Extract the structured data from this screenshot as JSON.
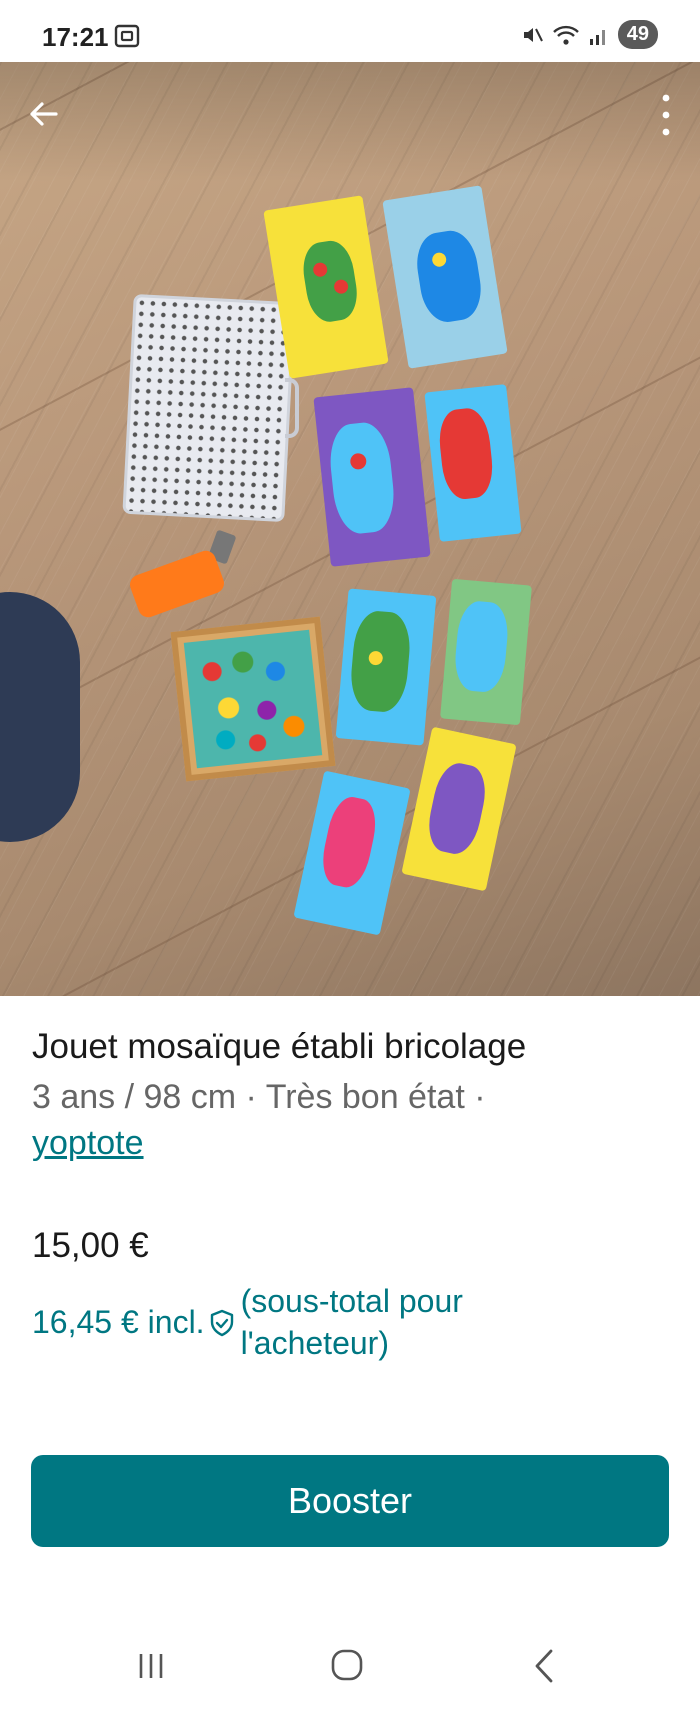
{
  "status_bar": {
    "time": "17:21",
    "battery": "49",
    "icons": [
      "screenshot-icon",
      "mute-icon",
      "wifi-icon",
      "signal-icon"
    ]
  },
  "photo": {
    "image_count": 5,
    "active_index": 0,
    "icons": {
      "back": "arrow-left-icon",
      "more": "more-vertical-icon"
    }
  },
  "item": {
    "title": "Jouet mosaïque établi bricolage",
    "subtitle": "3 ans / 98 cm · Très bon état ·",
    "seller": "yoptote",
    "price": "15,00 €",
    "price_incl": "16,45 € incl.",
    "price_incl_note": "(sous-total pour l'acheteur)"
  },
  "actions": {
    "booster_label": "Booster"
  },
  "nav_bar": {
    "icons": [
      "recent-apps-icon",
      "home-icon",
      "back-icon"
    ]
  },
  "colors": {
    "accent": "#007782",
    "text": "#1a1a1a",
    "muted": "#666666"
  }
}
